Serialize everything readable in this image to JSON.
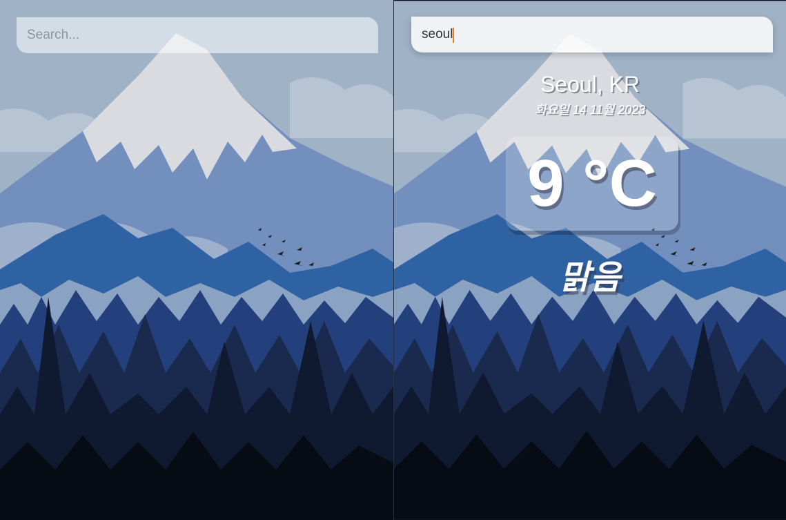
{
  "search": {
    "placeholder": "Search...",
    "value": "seoul"
  },
  "weather": {
    "location": "Seoul, KR",
    "date": "화요일 14 11월 2023",
    "temperature": "9 °C",
    "condition": "맑음"
  },
  "colors": {
    "sky": "#9fb3c8",
    "snow": "#d4d8df",
    "mountain": "#6f8ec0",
    "front_mountain": "#2a5c9a",
    "forest": "#1c2e5a",
    "caret": "#e07820"
  }
}
